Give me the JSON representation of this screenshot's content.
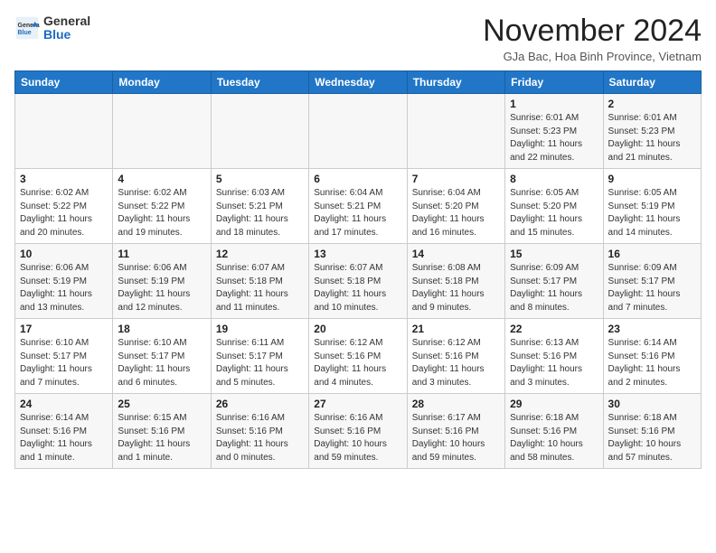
{
  "header": {
    "logo_general": "General",
    "logo_blue": "Blue",
    "month_title": "November 2024",
    "location": "GJa Bac, Hoa Binh Province, Vietnam"
  },
  "weekdays": [
    "Sunday",
    "Monday",
    "Tuesday",
    "Wednesday",
    "Thursday",
    "Friday",
    "Saturday"
  ],
  "weeks": [
    [
      {
        "day": "",
        "info": ""
      },
      {
        "day": "",
        "info": ""
      },
      {
        "day": "",
        "info": ""
      },
      {
        "day": "",
        "info": ""
      },
      {
        "day": "",
        "info": ""
      },
      {
        "day": "1",
        "info": "Sunrise: 6:01 AM\nSunset: 5:23 PM\nDaylight: 11 hours\nand 22 minutes."
      },
      {
        "day": "2",
        "info": "Sunrise: 6:01 AM\nSunset: 5:23 PM\nDaylight: 11 hours\nand 21 minutes."
      }
    ],
    [
      {
        "day": "3",
        "info": "Sunrise: 6:02 AM\nSunset: 5:22 PM\nDaylight: 11 hours\nand 20 minutes."
      },
      {
        "day": "4",
        "info": "Sunrise: 6:02 AM\nSunset: 5:22 PM\nDaylight: 11 hours\nand 19 minutes."
      },
      {
        "day": "5",
        "info": "Sunrise: 6:03 AM\nSunset: 5:21 PM\nDaylight: 11 hours\nand 18 minutes."
      },
      {
        "day": "6",
        "info": "Sunrise: 6:04 AM\nSunset: 5:21 PM\nDaylight: 11 hours\nand 17 minutes."
      },
      {
        "day": "7",
        "info": "Sunrise: 6:04 AM\nSunset: 5:20 PM\nDaylight: 11 hours\nand 16 minutes."
      },
      {
        "day": "8",
        "info": "Sunrise: 6:05 AM\nSunset: 5:20 PM\nDaylight: 11 hours\nand 15 minutes."
      },
      {
        "day": "9",
        "info": "Sunrise: 6:05 AM\nSunset: 5:19 PM\nDaylight: 11 hours\nand 14 minutes."
      }
    ],
    [
      {
        "day": "10",
        "info": "Sunrise: 6:06 AM\nSunset: 5:19 PM\nDaylight: 11 hours\nand 13 minutes."
      },
      {
        "day": "11",
        "info": "Sunrise: 6:06 AM\nSunset: 5:19 PM\nDaylight: 11 hours\nand 12 minutes."
      },
      {
        "day": "12",
        "info": "Sunrise: 6:07 AM\nSunset: 5:18 PM\nDaylight: 11 hours\nand 11 minutes."
      },
      {
        "day": "13",
        "info": "Sunrise: 6:07 AM\nSunset: 5:18 PM\nDaylight: 11 hours\nand 10 minutes."
      },
      {
        "day": "14",
        "info": "Sunrise: 6:08 AM\nSunset: 5:18 PM\nDaylight: 11 hours\nand 9 minutes."
      },
      {
        "day": "15",
        "info": "Sunrise: 6:09 AM\nSunset: 5:17 PM\nDaylight: 11 hours\nand 8 minutes."
      },
      {
        "day": "16",
        "info": "Sunrise: 6:09 AM\nSunset: 5:17 PM\nDaylight: 11 hours\nand 7 minutes."
      }
    ],
    [
      {
        "day": "17",
        "info": "Sunrise: 6:10 AM\nSunset: 5:17 PM\nDaylight: 11 hours\nand 7 minutes."
      },
      {
        "day": "18",
        "info": "Sunrise: 6:10 AM\nSunset: 5:17 PM\nDaylight: 11 hours\nand 6 minutes."
      },
      {
        "day": "19",
        "info": "Sunrise: 6:11 AM\nSunset: 5:17 PM\nDaylight: 11 hours\nand 5 minutes."
      },
      {
        "day": "20",
        "info": "Sunrise: 6:12 AM\nSunset: 5:16 PM\nDaylight: 11 hours\nand 4 minutes."
      },
      {
        "day": "21",
        "info": "Sunrise: 6:12 AM\nSunset: 5:16 PM\nDaylight: 11 hours\nand 3 minutes."
      },
      {
        "day": "22",
        "info": "Sunrise: 6:13 AM\nSunset: 5:16 PM\nDaylight: 11 hours\nand 3 minutes."
      },
      {
        "day": "23",
        "info": "Sunrise: 6:14 AM\nSunset: 5:16 PM\nDaylight: 11 hours\nand 2 minutes."
      }
    ],
    [
      {
        "day": "24",
        "info": "Sunrise: 6:14 AM\nSunset: 5:16 PM\nDaylight: 11 hours\nand 1 minute."
      },
      {
        "day": "25",
        "info": "Sunrise: 6:15 AM\nSunset: 5:16 PM\nDaylight: 11 hours\nand 1 minute."
      },
      {
        "day": "26",
        "info": "Sunrise: 6:16 AM\nSunset: 5:16 PM\nDaylight: 11 hours\nand 0 minutes."
      },
      {
        "day": "27",
        "info": "Sunrise: 6:16 AM\nSunset: 5:16 PM\nDaylight: 10 hours\nand 59 minutes."
      },
      {
        "day": "28",
        "info": "Sunrise: 6:17 AM\nSunset: 5:16 PM\nDaylight: 10 hours\nand 59 minutes."
      },
      {
        "day": "29",
        "info": "Sunrise: 6:18 AM\nSunset: 5:16 PM\nDaylight: 10 hours\nand 58 minutes."
      },
      {
        "day": "30",
        "info": "Sunrise: 6:18 AM\nSunset: 5:16 PM\nDaylight: 10 hours\nand 57 minutes."
      }
    ]
  ]
}
